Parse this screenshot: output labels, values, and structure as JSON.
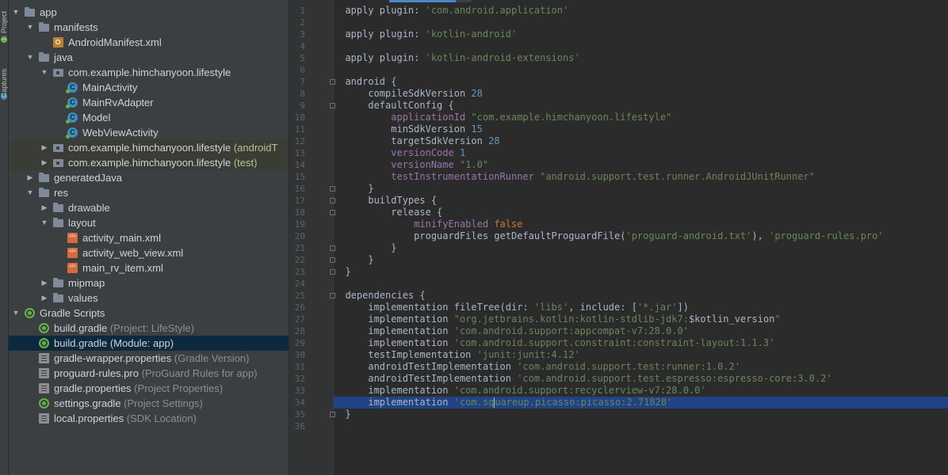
{
  "side_strip": {
    "tabs": [
      {
        "label": "1: Project",
        "icon": "project-icon",
        "color": "#62b543"
      },
      {
        "label": "Captures",
        "icon": "captures-icon",
        "color": "#3d8fba"
      }
    ]
  },
  "project_tree": [
    {
      "label": "app",
      "arrow": "down",
      "icon": "folder-icon",
      "depth": 0,
      "bold": true
    },
    {
      "label": "manifests",
      "arrow": "down",
      "icon": "folder-icon",
      "depth": 1
    },
    {
      "label": "AndroidManifest.xml",
      "arrow": "",
      "icon": "manifest-icon",
      "depth": 2
    },
    {
      "label": "java",
      "arrow": "down",
      "icon": "folder-icon",
      "depth": 1
    },
    {
      "label": "com.example.himchanyoon.lifestyle",
      "arrow": "down",
      "icon": "package-icon",
      "depth": 2
    },
    {
      "label": "MainActivity",
      "arrow": "",
      "icon": "class-icon",
      "depth": 3
    },
    {
      "label": "MainRvAdapter",
      "arrow": "",
      "icon": "class-icon",
      "depth": 3
    },
    {
      "label": "Model",
      "arrow": "",
      "icon": "class-icon",
      "depth": 3
    },
    {
      "label": "WebViewActivity",
      "arrow": "",
      "icon": "class-icon",
      "depth": 3
    },
    {
      "label": "com.example.himchanyoon.lifestyle",
      "suffix": "(androidT",
      "suffix_style": "green",
      "arrow": "right",
      "icon": "package-icon",
      "depth": 2,
      "highlight": true
    },
    {
      "label": "com.example.himchanyoon.lifestyle",
      "suffix": "(test)",
      "suffix_style": "green",
      "arrow": "right",
      "icon": "package-icon",
      "depth": 2,
      "highlight": true
    },
    {
      "label": "generatedJava",
      "arrow": "right",
      "icon": "folder-icon",
      "depth": 1
    },
    {
      "label": "res",
      "arrow": "down",
      "icon": "folder-icon",
      "depth": 1
    },
    {
      "label": "drawable",
      "arrow": "right",
      "icon": "folder-icon",
      "depth": 2
    },
    {
      "label": "layout",
      "arrow": "down",
      "icon": "folder-icon",
      "depth": 2
    },
    {
      "label": "activity_main.xml",
      "arrow": "",
      "icon": "xml-icon",
      "depth": 3
    },
    {
      "label": "activity_web_view.xml",
      "arrow": "",
      "icon": "xml-icon",
      "depth": 3
    },
    {
      "label": "main_rv_item.xml",
      "arrow": "",
      "icon": "xml-icon",
      "depth": 3
    },
    {
      "label": "mipmap",
      "arrow": "right",
      "icon": "folder-icon",
      "depth": 2
    },
    {
      "label": "values",
      "arrow": "right",
      "icon": "folder-icon",
      "depth": 2
    },
    {
      "label": "Gradle Scripts",
      "arrow": "down",
      "icon": "gradle-icon",
      "depth": 0
    },
    {
      "label": "build.gradle",
      "suffix": "(Project: LifeStyle)",
      "suffix_style": "dim",
      "arrow": "",
      "icon": "gradle-icon",
      "depth": 1
    },
    {
      "label": "build.gradle",
      "suffix": "(Module: app)",
      "suffix_style": "plain",
      "arrow": "",
      "icon": "gradle-icon",
      "depth": 1,
      "selected": true
    },
    {
      "label": "gradle-wrapper.properties",
      "suffix": "(Gradle Version)",
      "suffix_style": "dim",
      "arrow": "",
      "icon": "properties-icon",
      "depth": 1
    },
    {
      "label": "proguard-rules.pro",
      "suffix": "(ProGuard Rules for app)",
      "suffix_style": "dim",
      "arrow": "",
      "icon": "properties-icon",
      "depth": 1
    },
    {
      "label": "gradle.properties",
      "suffix": "(Project Properties)",
      "suffix_style": "dim",
      "arrow": "",
      "icon": "properties-icon",
      "depth": 1
    },
    {
      "label": "settings.gradle",
      "suffix": "(Project Settings)",
      "suffix_style": "dim",
      "arrow": "",
      "icon": "gradle-icon",
      "depth": 1
    },
    {
      "label": "local.properties",
      "suffix": "(SDK Location)",
      "suffix_style": "dim",
      "arrow": "",
      "icon": "properties-icon",
      "depth": 1
    }
  ],
  "editor": {
    "colors": {
      "plain": "#a9b7c6",
      "str": "#6a8759",
      "num": "#6897bb",
      "kw": "#cc7832",
      "prop": "#9876aa",
      "sel_line": "#214283"
    },
    "cursor_line": 34,
    "fold_lines": [
      7,
      9,
      16,
      17,
      18,
      21,
      22,
      23,
      25,
      35
    ],
    "lines": [
      [
        [
          "plain",
          "apply plugin: "
        ],
        [
          "str",
          "'com.android.application'"
        ]
      ],
      [],
      [
        [
          "plain",
          "apply plugin: "
        ],
        [
          "str",
          "'kotlin-android'"
        ]
      ],
      [],
      [
        [
          "plain",
          "apply plugin: "
        ],
        [
          "str",
          "'kotlin-android-extensions'"
        ]
      ],
      [],
      [
        [
          "plain",
          "android {"
        ]
      ],
      [
        [
          "plain",
          "    compileSdkVersion "
        ],
        [
          "num",
          "28"
        ]
      ],
      [
        [
          "plain",
          "    defaultConfig {"
        ]
      ],
      [
        [
          "plain",
          "        "
        ],
        [
          "prop",
          "applicationId "
        ],
        [
          "str",
          "\"com.example.himchanyoon.lifestyle\""
        ]
      ],
      [
        [
          "plain",
          "        minSdkVersion "
        ],
        [
          "num",
          "15"
        ]
      ],
      [
        [
          "plain",
          "        targetSdkVersion "
        ],
        [
          "num",
          "28"
        ]
      ],
      [
        [
          "plain",
          "        "
        ],
        [
          "prop",
          "versionCode "
        ],
        [
          "num",
          "1"
        ]
      ],
      [
        [
          "plain",
          "        "
        ],
        [
          "prop",
          "versionName "
        ],
        [
          "str",
          "\"1.0\""
        ]
      ],
      [
        [
          "plain",
          "        "
        ],
        [
          "prop",
          "testInstrumentationRunner "
        ],
        [
          "str",
          "\"android.support.test.runner.AndroidJUnitRunner\""
        ]
      ],
      [
        [
          "plain",
          "    }"
        ]
      ],
      [
        [
          "plain",
          "    buildTypes {"
        ]
      ],
      [
        [
          "plain",
          "        release {"
        ]
      ],
      [
        [
          "plain",
          "            "
        ],
        [
          "prop",
          "minifyEnabled "
        ],
        [
          "kw",
          "false"
        ]
      ],
      [
        [
          "plain",
          "            proguardFiles getDefaultProguardFile("
        ],
        [
          "str",
          "'proguard-android.txt'"
        ],
        [
          "plain",
          "), "
        ],
        [
          "str",
          "'proguard-rules.pro'"
        ]
      ],
      [
        [
          "plain",
          "        }"
        ]
      ],
      [
        [
          "plain",
          "    }"
        ]
      ],
      [
        [
          "plain",
          "}"
        ]
      ],
      [],
      [
        [
          "plain",
          "dependencies {"
        ]
      ],
      [
        [
          "plain",
          "    implementation fileTree(dir: "
        ],
        [
          "str",
          "'libs'"
        ],
        [
          "plain",
          ", include: ["
        ],
        [
          "str",
          "'*.jar'"
        ],
        [
          "plain",
          "])"
        ]
      ],
      [
        [
          "plain",
          "    implementation "
        ],
        [
          "str",
          "\"org.jetbrains.kotlin:kotlin-stdlib-jdk7:"
        ],
        [
          "plain",
          "$kotlin_version"
        ],
        [
          "str",
          "\""
        ]
      ],
      [
        [
          "plain",
          "    implementation "
        ],
        [
          "str",
          "'com.android.support:appcompat-v7:28.0.0'"
        ]
      ],
      [
        [
          "plain",
          "    implementation "
        ],
        [
          "str",
          "'com.android.support.constraint:constraint-layout:1.1.3'"
        ]
      ],
      [
        [
          "plain",
          "    testImplementation "
        ],
        [
          "str",
          "'junit:junit:4.12'"
        ]
      ],
      [
        [
          "plain",
          "    androidTestImplementation "
        ],
        [
          "str",
          "'com.android.support.test:runner:1.0.2'"
        ]
      ],
      [
        [
          "plain",
          "    androidTestImplementation "
        ],
        [
          "str",
          "'com.android.support.test.espresso:espresso-core:3.0.2'"
        ]
      ],
      [
        [
          "plain",
          "    implementation "
        ],
        [
          "str",
          "'com.android.support:recyclerview-v7:28.0.0'"
        ]
      ],
      [
        [
          "plain",
          "    implementation "
        ],
        [
          "str",
          "'com.sq"
        ],
        [
          "caret",
          ""
        ],
        [
          "str",
          "uareup.picasso:picasso:2.71828'"
        ]
      ],
      [
        [
          "plain",
          "}"
        ]
      ],
      []
    ]
  }
}
